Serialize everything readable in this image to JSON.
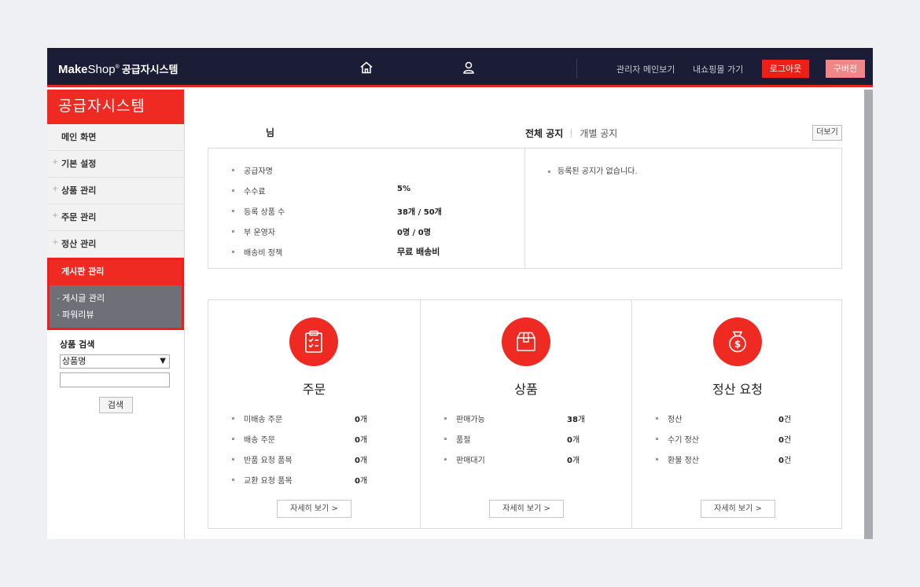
{
  "header": {
    "logo_make": "Make",
    "logo_shop": "Shop",
    "logo_reg": "®",
    "logo_system": "공급자시스템",
    "home_icon": "home-icon",
    "user_icon": "user-icon",
    "admin_main_link": "관리자 메인보기",
    "shop_link": "내쇼핑몰 가기",
    "logout_label": "로그아웃",
    "old_version_label": "구버전"
  },
  "sidebar": {
    "title": "공급자시스템",
    "items": [
      {
        "label": "메인 화면",
        "plus": ""
      },
      {
        "label": "기본 설정",
        "plus": "+"
      },
      {
        "label": "상품 관리",
        "plus": "+"
      },
      {
        "label": "주문 관리",
        "plus": "+"
      },
      {
        "label": "정산 관리",
        "plus": "+"
      }
    ],
    "active": {
      "label": "게시판 관리",
      "subitems": [
        "게시글 관리",
        "파워리뷰"
      ]
    },
    "search": {
      "title": "상품 검색",
      "select_value": "상품명",
      "input_value": "",
      "button_label": "검색"
    }
  },
  "main": {
    "greeting": "님",
    "notice_tabs": [
      "전체 공지",
      "개별 공지"
    ],
    "more_label": "더보기",
    "info": [
      {
        "label": "공급자명",
        "value": ""
      },
      {
        "label": "수수료",
        "value": "5%"
      },
      {
        "label": "등록 상품 수",
        "value": "38개 / 50개"
      },
      {
        "label": "부 운영자",
        "value": "0명 / 0명"
      },
      {
        "label": "배송비 정책",
        "value": "무료 배송비"
      }
    ],
    "notice_empty": "등록된 공지가 없습니다.",
    "cards": [
      {
        "title": "주문",
        "icon": "clipboard-checklist-icon",
        "rows": [
          {
            "label": "미배송 주문",
            "num": "0",
            "unit": "개"
          },
          {
            "label": "배송 주문",
            "num": "0",
            "unit": "개"
          },
          {
            "label": "반품 요청 품목",
            "num": "0",
            "unit": "개"
          },
          {
            "label": "교환 요청 품목",
            "num": "0",
            "unit": "개"
          }
        ],
        "detail_label": "자세히 보기 >"
      },
      {
        "title": "상품",
        "icon": "box-icon",
        "rows": [
          {
            "label": "판매가능",
            "num": "38",
            "unit": "개"
          },
          {
            "label": "품절",
            "num": "0",
            "unit": "개"
          },
          {
            "label": "판매대기",
            "num": "0",
            "unit": "개"
          }
        ],
        "detail_label": "자세히 보기 >"
      },
      {
        "title": "정산 요청",
        "icon": "money-bag-icon",
        "rows": [
          {
            "label": "정산",
            "num": "0",
            "unit": "건"
          },
          {
            "label": "수기 정산",
            "num": "0",
            "unit": "건"
          },
          {
            "label": "환불 정산",
            "num": "0",
            "unit": "건"
          }
        ],
        "detail_label": "자세히 보기 >"
      }
    ]
  },
  "colors": {
    "accent": "#ee2a22",
    "topbar": "#1b1c35",
    "submenu_bg": "#6f6f78"
  }
}
